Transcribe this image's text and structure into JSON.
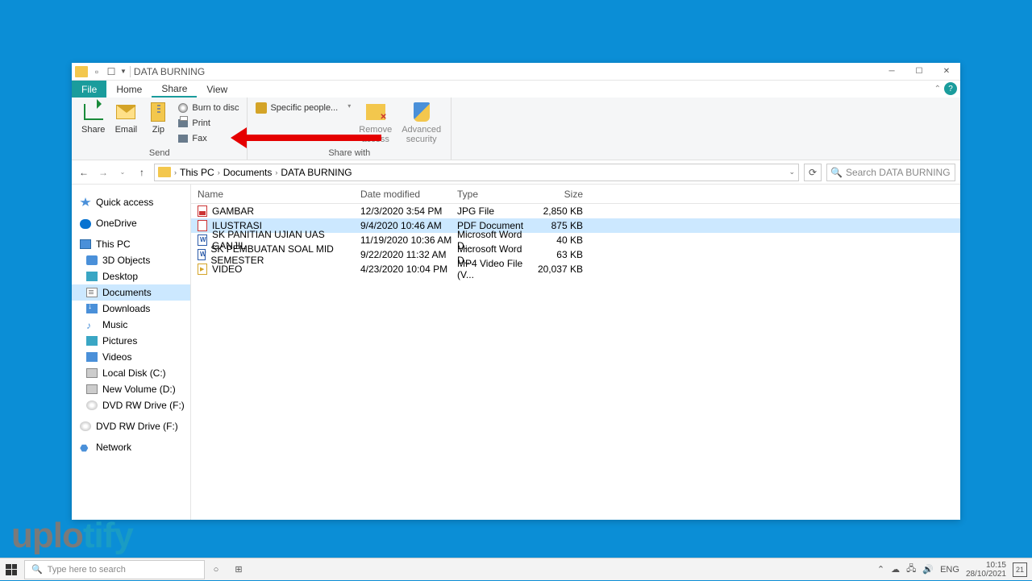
{
  "window": {
    "title": "DATA BURNING",
    "tabs": {
      "file": "File",
      "home": "Home",
      "share": "Share",
      "view": "View"
    },
    "ribbon": {
      "send_group": "Send",
      "sharewith_group": "Share with",
      "share": "Share",
      "email": "Email",
      "zip": "Zip",
      "burn": "Burn to disc",
      "print": "Print",
      "fax": "Fax",
      "specific": "Specific people...",
      "remove1": "Remove",
      "remove2": "access",
      "adv1": "Advanced",
      "adv2": "security"
    }
  },
  "nav": {
    "crumbs": [
      "This PC",
      "Documents",
      "DATA BURNING"
    ],
    "search_placeholder": "Search DATA BURNING"
  },
  "sidebar": {
    "quick": "Quick access",
    "onedrive": "OneDrive",
    "thispc": "This PC",
    "children": [
      "3D Objects",
      "Desktop",
      "Documents",
      "Downloads",
      "Music",
      "Pictures",
      "Videos",
      "Local Disk (C:)",
      "New Volume (D:)",
      "DVD RW Drive (F:)"
    ],
    "dvd2": "DVD RW Drive (F:)",
    "network": "Network"
  },
  "columns": {
    "name": "Name",
    "date": "Date modified",
    "type": "Type",
    "size": "Size"
  },
  "files": [
    {
      "name": "GAMBAR",
      "date": "12/3/2020 3:54 PM",
      "type": "JPG File",
      "size": "2,850 KB",
      "icon": "fi-jpg"
    },
    {
      "name": "ILUSTRASI",
      "date": "9/4/2020 10:46 AM",
      "type": "PDF Document",
      "size": "875 KB",
      "icon": "fi-pdf"
    },
    {
      "name": "SK PANITIAN UJIAN UAS GANJIL",
      "date": "11/19/2020 10:36 AM",
      "type": "Microsoft Word D...",
      "size": "40 KB",
      "icon": "fi-doc"
    },
    {
      "name": "SK PEMBUATAN SOAL MID SEMESTER",
      "date": "9/22/2020 11:32 AM",
      "type": "Microsoft Word D...",
      "size": "63 KB",
      "icon": "fi-doc"
    },
    {
      "name": "VIDEO",
      "date": "4/23/2020 10:04 PM",
      "type": "MP4 Video File (V...",
      "size": "20,037 KB",
      "icon": "fi-mp4"
    }
  ],
  "watermark": {
    "a": "uplo",
    "b": "tify"
  },
  "taskbar": {
    "search": "Type here to search",
    "lang": "ENG",
    "time": "10:15",
    "date": "28/10/2021",
    "notif": "21"
  }
}
